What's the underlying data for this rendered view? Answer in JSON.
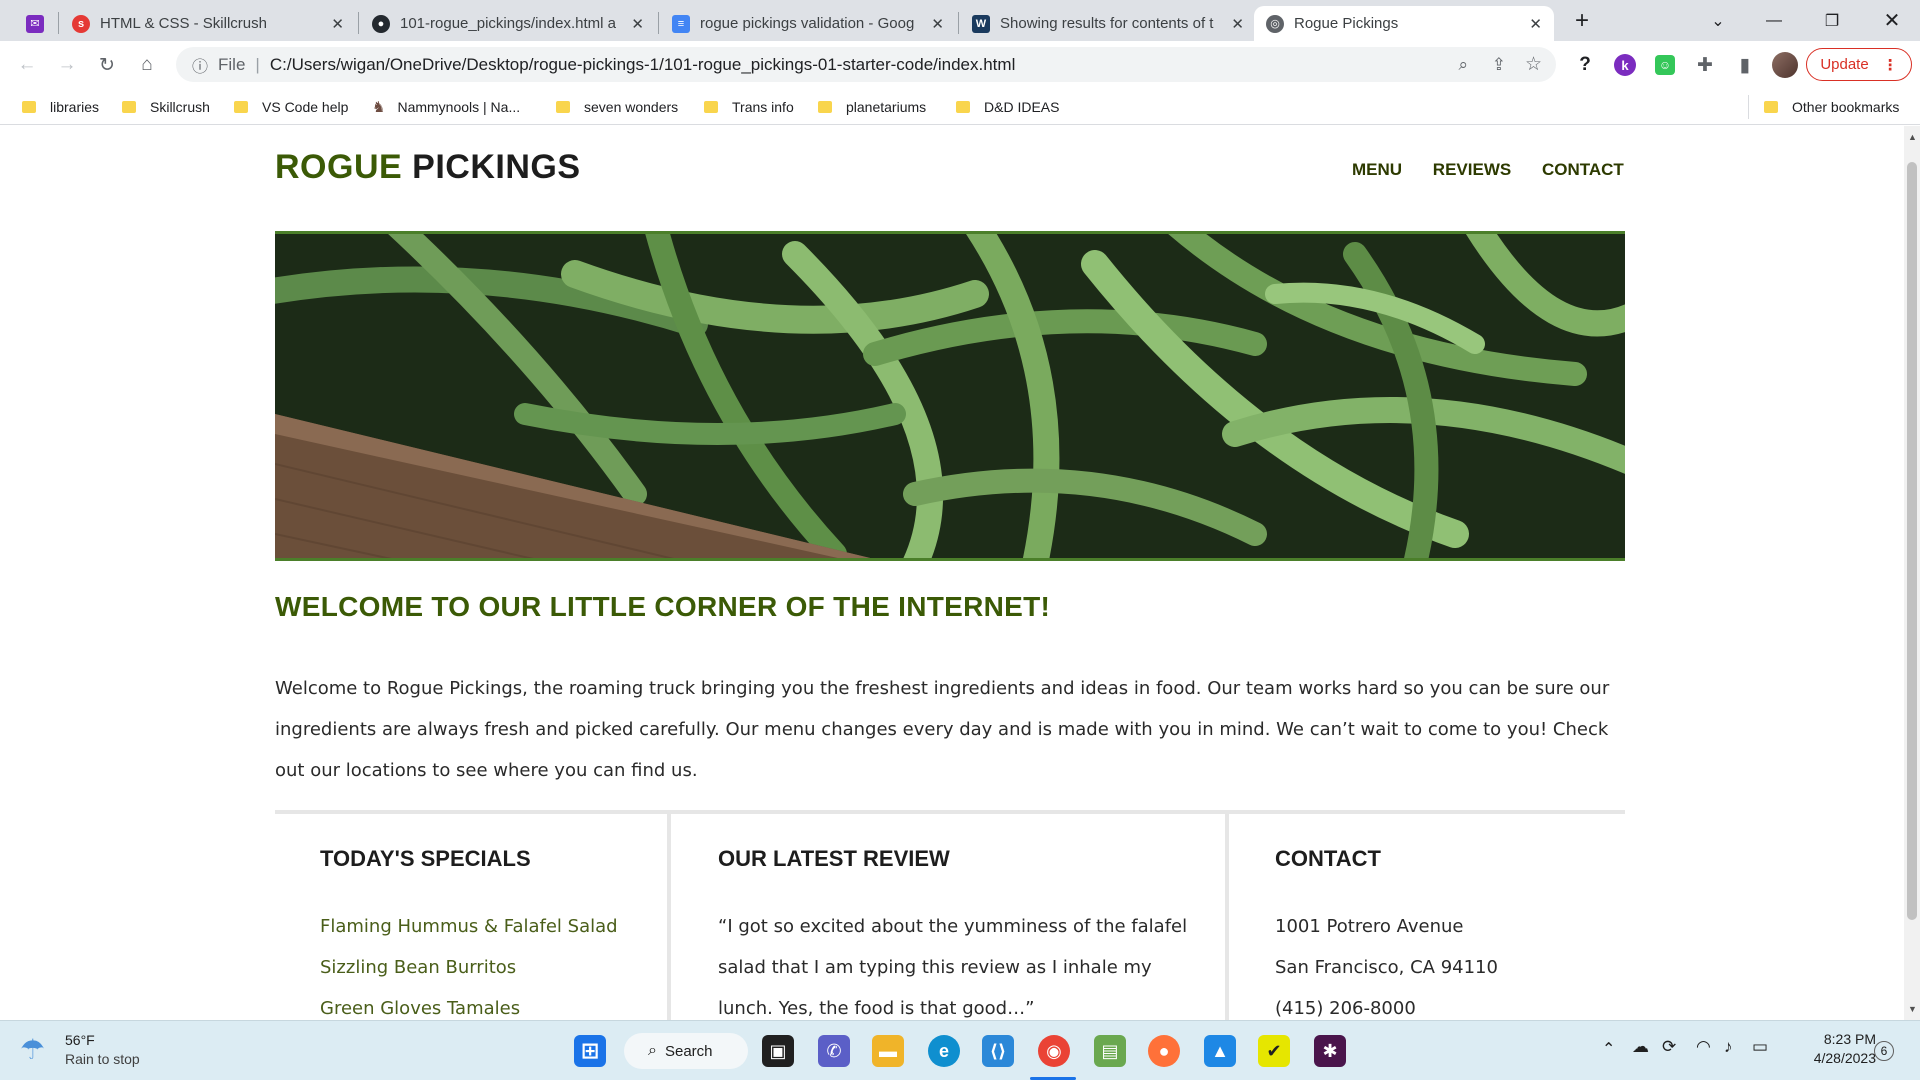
{
  "browser": {
    "tabs": [
      {
        "label": "HTML & CSS - Skillcrush",
        "icon": "skillcrush-icon"
      },
      {
        "label": "101-rogue_pickings/index.html a",
        "icon": "github-icon"
      },
      {
        "label": "rogue pickings validation - Goog",
        "icon": "docs-icon"
      },
      {
        "label": "Showing results for contents of t",
        "icon": "validator-icon"
      },
      {
        "label": "Rogue Pickings",
        "icon": "globe-icon"
      }
    ],
    "url_prefix": "File",
    "url": "C:/Users/wigan/OneDrive/Desktop/rogue-pickings-1/101-rogue_pickings-01-starter-code/index.html",
    "update_label": "Update",
    "bookmarks": [
      "libraries",
      "Skillcrush",
      "VS Code help",
      "Nammynools | Na...",
      "seven wonders",
      "Trans info",
      "planetariums",
      "D&D IDEAS"
    ],
    "other_bookmarks": "Other bookmarks"
  },
  "site": {
    "logo_part1": "ROGUE",
    "logo_part2": "PICKINGS",
    "nav": [
      "MENU",
      "REVIEWS",
      "CONTACT"
    ],
    "welcome_heading": "WELCOME TO OUR LITTLE CORNER OF THE INTERNET!",
    "intro": "Welcome to Rogue Pickings, the roaming truck bringing you the freshest ingredients and ideas in food. Our team works hard so you can be sure our ingredients are always fresh and picked carefully. Our menu changes every day and is made with you in mind. We can’t wait to come to you! Check out our locations to see where you can find us.",
    "specials": {
      "heading": "TODAY'S SPECIALS",
      "items": [
        "Flaming Hummus & Falafel Salad",
        "Sizzling Bean Burritos",
        "Green Gloves Tamales"
      ]
    },
    "review": {
      "heading": "OUR LATEST REVIEW",
      "text": "“I got so excited about the yumminess of the falafel salad that I am typing this review as I inhale my lunch. Yes, the food is that good…”"
    },
    "contact": {
      "heading": "CONTACT",
      "lines": [
        "1001 Potrero Avenue",
        "San Francisco, CA 94110",
        "(415) 206-8000"
      ]
    },
    "colors": {
      "accent": "#3b5a06",
      "dark": "#1d1d1d",
      "link": "#4a5e1a"
    }
  },
  "taskbar": {
    "weather_temp": "56°F",
    "weather_desc": "Rain to stop",
    "search_label": "Search",
    "time": "8:23 PM",
    "date": "4/28/2023",
    "notification_count": "6"
  }
}
